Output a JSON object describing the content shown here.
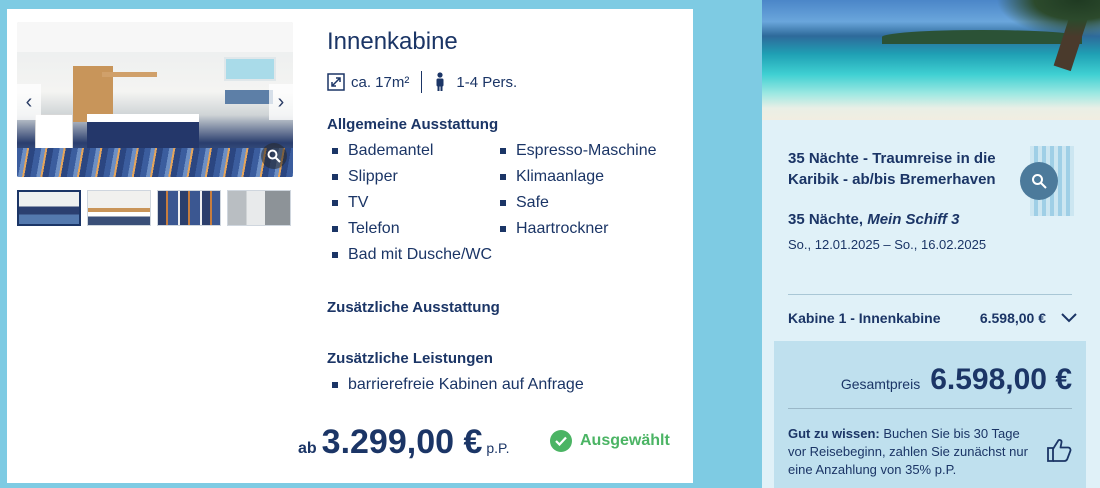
{
  "cabin": {
    "title": "Innenkabine",
    "size": "ca. 17m²",
    "persons": "1-4 Pers.",
    "gallery": {
      "thumbnails": [
        "room-view",
        "room-view-2",
        "floor-plan",
        "bathroom"
      ],
      "active_index": 0
    },
    "equipment_heading": "Allgemeine Ausstattung",
    "equipment_left": [
      "Bademantel",
      "Slipper",
      "TV",
      "Telefon",
      "Bad mit Dusche/WC"
    ],
    "equipment_right": [
      "Espresso-Maschine",
      "Klimaanlage",
      "Safe",
      "Haartrockner"
    ],
    "extra_equipment_heading": "Zusätzliche Ausstattung",
    "extra_services_heading": "Zusätzliche Leistungen",
    "extra_services": [
      "barrierefreie Kabinen auf Anfrage"
    ],
    "price_prefix": "ab",
    "price": "3.299,00 €",
    "price_suffix": "p.P.",
    "selected_label": "Ausgewählt"
  },
  "summary": {
    "trip_title": "35 Nächte - Traumreise in die Karibik - ab/bis Bremerhaven",
    "ship_prefix": "35 Nächte, ",
    "ship_name": "Mein Schiff 3",
    "dates": "So., 12.01.2025 – So., 16.02.2025",
    "cabin_label": "Kabine 1 - Innenkabine",
    "cabin_price": "6.598,00 €",
    "total_label": "Gesamtpreis",
    "total_value": "6.598,00 €",
    "info_bold": "Gut zu wissen:",
    "info_text": " Buchen Sie bis 30 Tage vor Reisebeginn, zahlen Sie zunächst nur eine Anzahlung von 35% p.P."
  },
  "colors": {
    "brand_navy": "#1b3566",
    "success_green": "#4bb464",
    "page_bg": "#7ecbe3",
    "panel_bg": "#e0f1f8",
    "total_bg": "#bfe0ee"
  },
  "icons": [
    "chevron-left-icon",
    "chevron-right-icon",
    "search-icon",
    "area-icon",
    "person-icon",
    "check-circle-icon",
    "chevron-down-icon",
    "thumbs-up-icon"
  ]
}
